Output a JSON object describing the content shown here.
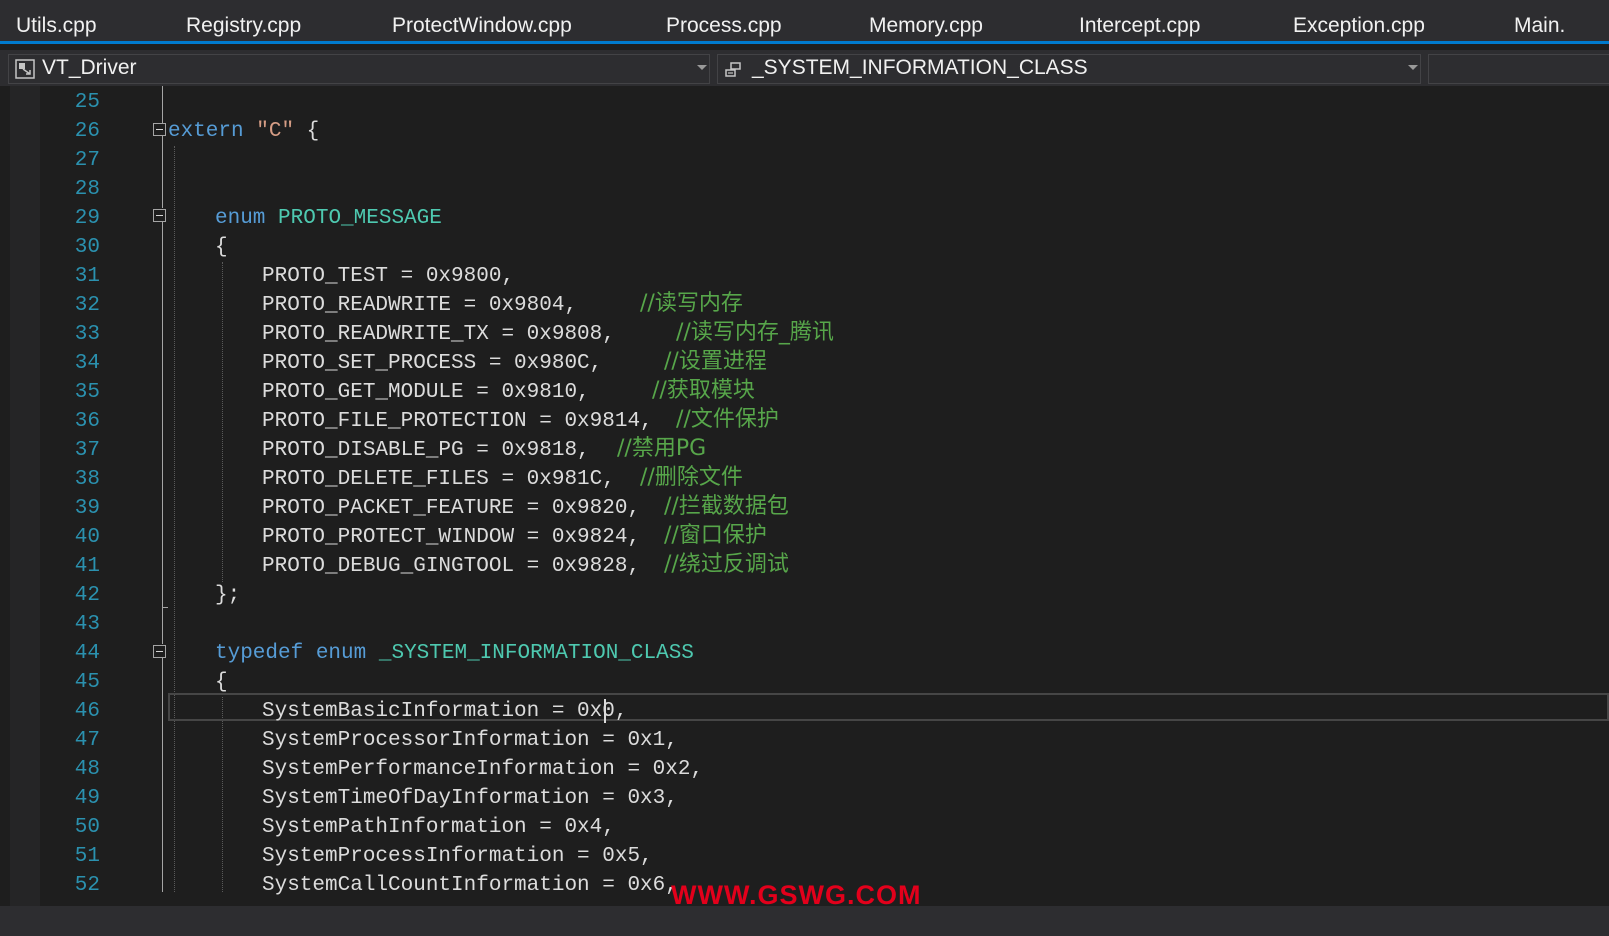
{
  "tabs": [
    {
      "label": "Utils.cpp"
    },
    {
      "label": "Registry.cpp"
    },
    {
      "label": "ProtectWindow.cpp"
    },
    {
      "label": "Process.cpp"
    },
    {
      "label": "Memory.cpp"
    },
    {
      "label": "Intercept.cpp"
    },
    {
      "label": "Exception.cpp"
    },
    {
      "label": "Main."
    }
  ],
  "navbar": {
    "project": "VT_Driver",
    "member": "_SYSTEM_INFORMATION_CLASS"
  },
  "editor": {
    "line_numbers": [
      "25",
      "26",
      "27",
      "28",
      "29",
      "30",
      "31",
      "32",
      "33",
      "34",
      "35",
      "36",
      "37",
      "38",
      "39",
      "40",
      "41",
      "42",
      "43",
      "44",
      "45",
      "46",
      "47",
      "48",
      "49",
      "50",
      "51",
      "52"
    ],
    "extern_kw": "extern",
    "extern_str": "\"C\"",
    "extern_brace": "{",
    "enum_kw": "enum",
    "enum_name": "PROTO_MESSAGE",
    "open_brace": "{",
    "close_enum": "};",
    "proto_entries": [
      {
        "code": "PROTO_TEST = 0x9800,",
        "comment": ""
      },
      {
        "code": "PROTO_READWRITE = 0x9804,",
        "comment": "//读写内存"
      },
      {
        "code": "PROTO_READWRITE_TX = 0x9808,",
        "comment": "//读写内存_腾讯"
      },
      {
        "code": "PROTO_SET_PROCESS = 0x980C,",
        "comment": "//设置进程"
      },
      {
        "code": "PROTO_GET_MODULE = 0x9810,",
        "comment": "//获取模块"
      },
      {
        "code": "PROTO_FILE_PROTECTION = 0x9814,",
        "comment": "//文件保护"
      },
      {
        "code": "PROTO_DISABLE_PG = 0x9818,",
        "comment": "//禁用PG"
      },
      {
        "code": "PROTO_DELETE_FILES = 0x981C,",
        "comment": "//删除文件"
      },
      {
        "code": "PROTO_PACKET_FEATURE = 0x9820,",
        "comment": "//拦截数据包"
      },
      {
        "code": "PROTO_PROTECT_WINDOW = 0x9824,",
        "comment": "//窗口保护"
      },
      {
        "code": "PROTO_DEBUG_GINGTOOL = 0x9828,",
        "comment": "//绕过反调试"
      }
    ],
    "typedef_kw": "typedef",
    "typedef_enum_kw": "enum",
    "typedef_name": "_SYSTEM_INFORMATION_CLASS",
    "sys_entries": [
      "SystemBasicInformation = 0x0,",
      "SystemProcessorInformation = 0x1,",
      "SystemPerformanceInformation = 0x2,",
      "SystemTimeOfDayInformation = 0x3,",
      "SystemPathInformation = 0x4,",
      "SystemProcessInformation = 0x5,",
      "SystemCallCountInformation = 0x6,"
    ]
  },
  "watermark": "WWW.GSWG.COM",
  "colors": {
    "keyword": "#569cd6",
    "type": "#4ec9b0",
    "string": "#d69d85",
    "comment": "#57a64a",
    "line_number": "#2b91af",
    "tab_accent": "#007acc",
    "watermark": "#e3001b"
  },
  "icons": {
    "project": "project-icon",
    "member": "enum-member-icon",
    "fold": "collapse-icon"
  }
}
